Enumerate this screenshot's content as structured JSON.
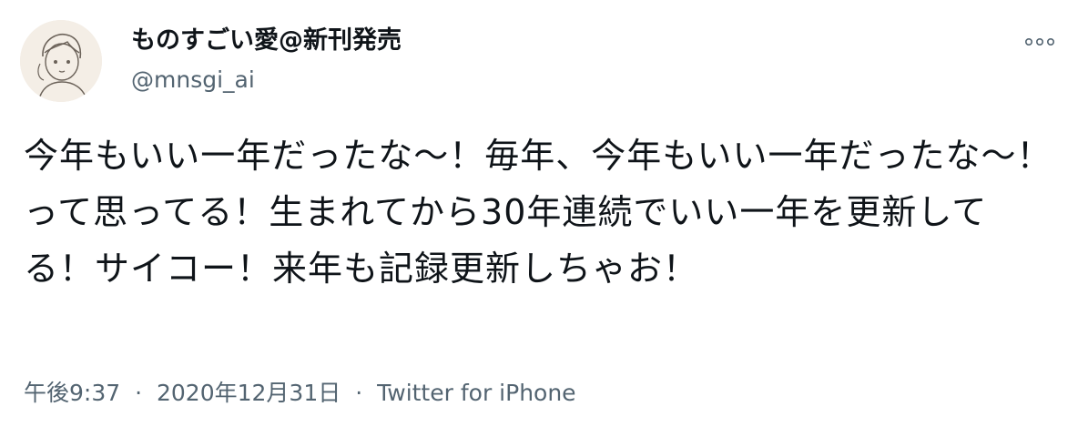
{
  "user": {
    "display_name": "ものすごい愛@新刊発売",
    "handle": "@mnsgi_ai",
    "avatar_icon": "avatar-illustration-icon"
  },
  "more_icon": "more-options-icon",
  "tweet": {
    "text": "今年もいい一年だったな〜！毎年、今年もいい一年だったな〜！って思ってる！生まれてから30年連続でいい一年を更新してる！サイコー！来年も記録更新しちゃお！"
  },
  "meta": {
    "time": "午後9:37",
    "separator": "·",
    "date": "2020年12月31日",
    "source": "Twitter for iPhone"
  },
  "colors": {
    "text": "#0f1419",
    "secondary": "#536471",
    "avatar_bg": "#f4eee6"
  }
}
